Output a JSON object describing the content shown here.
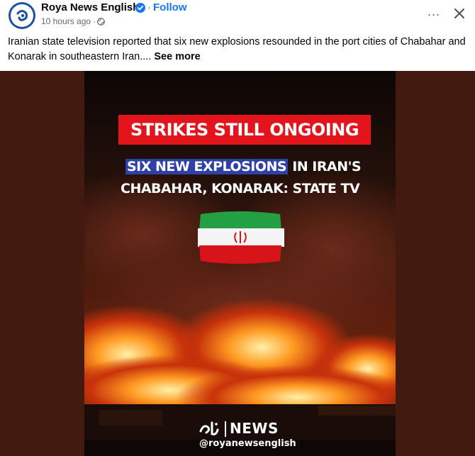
{
  "post": {
    "page_name": "Roya News English",
    "separator": "·",
    "follow_label": "Follow",
    "time": "10 hours ago ·",
    "text": "Iranian state television reported that six new explosions resounded in the port cities of Chabahar and Konarak in southeastern Iran....",
    "see_more": "See more",
    "more_icon": "...",
    "close_icon": "close-icon"
  },
  "media": {
    "banner": "STRIKES STILL ONGOING",
    "headline_highlight": "SIX NEW EXPLOSIONS",
    "headline_rest": " IN IRAN'S",
    "headline_line2": "CHABAHAR, KONARAK: STATE TV",
    "logo_text": "NEWS",
    "handle": "@royanewsenglish"
  },
  "colors": {
    "accent": "#1877f2",
    "banner_red": "#e3141b",
    "highlight_blue": "#2f41a8",
    "media_bg": "#431a10"
  }
}
